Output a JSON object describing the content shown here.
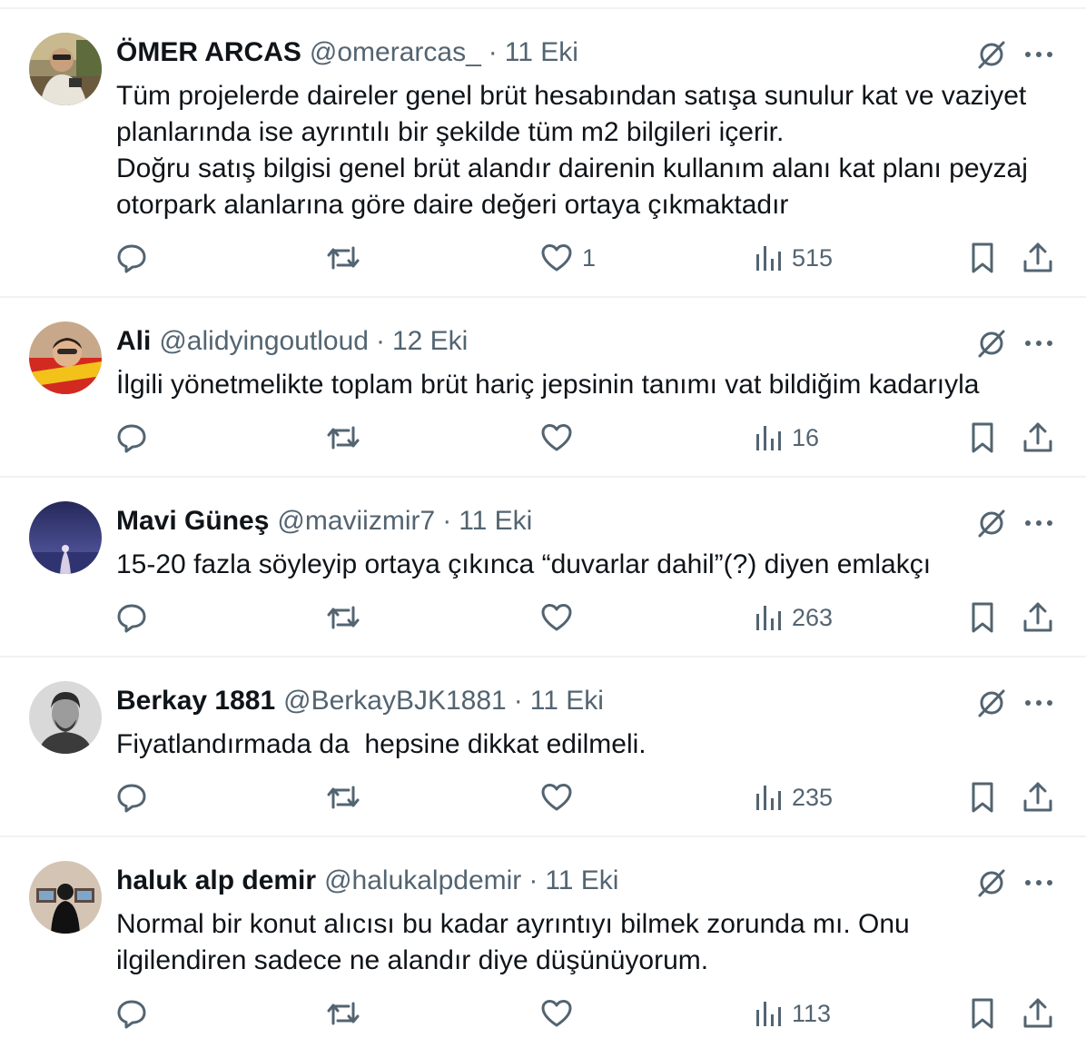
{
  "colors": {
    "text_primary": "#0f1419",
    "text_secondary": "#536471",
    "divider": "#eff3f4",
    "background": "#ffffff"
  },
  "icons": {
    "grok": "grok-icon",
    "more": "more-icon",
    "reply": "reply-icon",
    "retweet": "retweet-icon",
    "like": "heart-icon",
    "views": "views-icon",
    "bookmark": "bookmark-icon",
    "share": "share-icon"
  },
  "tweets": [
    {
      "name": "ÖMER ARCAS",
      "handle": "@omerarcas_",
      "separator": "·",
      "date": "11 Eki",
      "text_lines": [
        "Tüm projelerde daireler genel brüt hesabından satışa sunulur kat ve vaziyet",
        "planlarında ise ayrıntılı bir şekilde tüm m2 bilgileri içerir.",
        "Doğru satış bilgisi genel brüt alandır dairenin kullanım alanı kat planı peyzaj",
        "otorpark alanlarına göre daire değeri ortaya çıkmaktadır"
      ],
      "likes": "1",
      "views": "515"
    },
    {
      "name": "Ali",
      "handle": "@alidyingoutloud",
      "separator": "·",
      "date": "12 Eki",
      "text_lines": [
        "İlgili yönetmelikte toplam brüt hariç jepsinin tanımı vat bildiğim kadarıyla"
      ],
      "likes": "",
      "views": "16"
    },
    {
      "name": "Mavi Güneş",
      "handle": "@maviizmir7",
      "separator": "·",
      "date": "11 Eki",
      "text_lines": [
        "15-20 fazla söyleyip ortaya çıkınca “duvarlar dahil”(?) diyen emlakçı"
      ],
      "likes": "",
      "views": "263"
    },
    {
      "name": "Berkay 1881",
      "handle": "@BerkayBJK1881",
      "separator": "·",
      "date": "11 Eki",
      "text_lines": [
        "Fiyatlandırmada da  hepsine dikkat edilmeli."
      ],
      "likes": "",
      "views": "235"
    },
    {
      "name": "haluk alp demir",
      "handle": "@halukalpdemir",
      "separator": "·",
      "date": "11 Eki",
      "text_lines": [
        "Normal bir konut alıcısı bu kadar ayrıntıyı bilmek zorunda mı. Onu",
        "ilgilendiren sadece ne alandır diye düşünüyorum."
      ],
      "likes": "",
      "views": "113"
    }
  ]
}
